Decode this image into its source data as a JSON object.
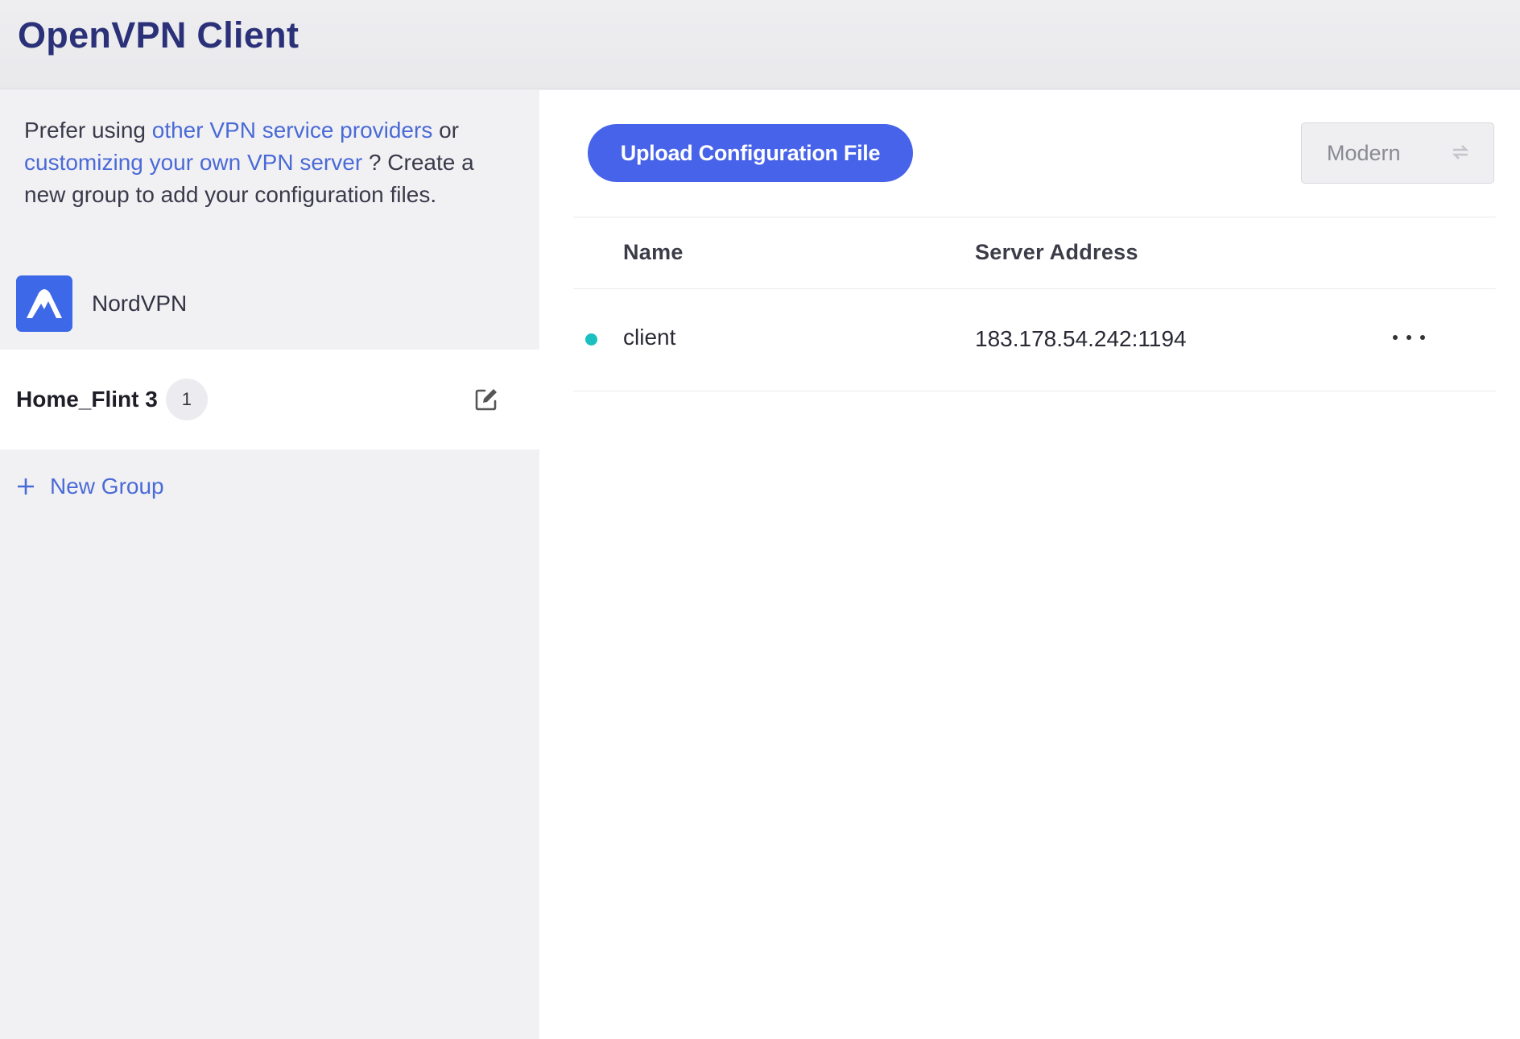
{
  "app": {
    "title": "OpenVPN Client"
  },
  "sidebar": {
    "intro": {
      "text_1": "Prefer using ",
      "link_1": "other VPN service providers",
      "text_2": " or ",
      "link_2": "customizing your own VPN server",
      "text_3": " ? Create a new group to add your configuration files."
    },
    "provider": {
      "name": "NordVPN",
      "icon": "nordvpn-logo"
    },
    "group": {
      "name": "Home_Flint 3",
      "count": "1",
      "edit_icon": "edit-icon"
    },
    "new_group": {
      "label": "New Group",
      "icon": "plus-icon"
    }
  },
  "main": {
    "upload_button": "Upload Configuration File",
    "mode": {
      "value": "Modern",
      "icon": "switch-icon"
    },
    "table": {
      "columns": [
        "Name",
        "Server Address"
      ],
      "rows": [
        {
          "status": "connected",
          "name": "client",
          "address": "183.178.54.242:1194",
          "more_icon": "more-icon"
        }
      ]
    }
  },
  "colors": {
    "accent": "#4763ea",
    "title": "#2b3178",
    "link": "#4a6ad6",
    "status_ok": "#1cbfbf"
  }
}
